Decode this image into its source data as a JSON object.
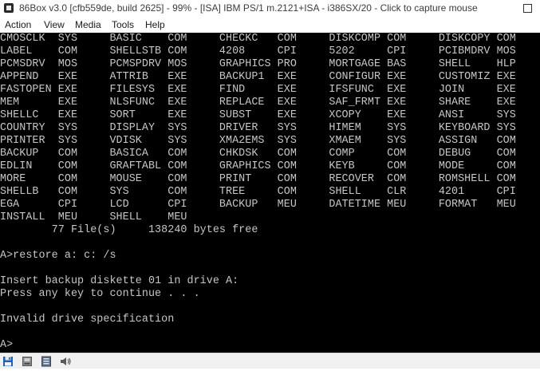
{
  "window": {
    "title": "86Box v3.0 [cfb559de, build 2625] - 99% - [ISA] IBM PS/1 m.2121+ISA - i386SX/20 - Click to capture mouse"
  },
  "menu": {
    "items": [
      "Action",
      "View",
      "Media",
      "Tools",
      "Help"
    ]
  },
  "terminal": {
    "lines": [
      "CMOSCLK  SYS     BASIC    COM     CHECKC   COM     DISKCOMP COM     DISKCOPY COM",
      "LABEL    COM     SHELLSTB COM     4208     CPI     5202     CPI     PCIBMDRV MOS",
      "PCMSDRV  MOS     PCMSPDRV MOS     GRAPHICS PRO     MORTGAGE BAS     SHELL    HLP",
      "APPEND   EXE     ATTRIB   EXE     BACKUP1  EXE     CONFIGUR EXE     CUSTOMIZ EXE",
      "FASTOPEN EXE     FILESYS  EXE     FIND     EXE     IFSFUNC  EXE     JOIN     EXE",
      "MEM      EXE     NLSFUNC  EXE     REPLACE  EXE     SAF_FRMT EXE     SHARE    EXE",
      "SHELLC   EXE     SORT     EXE     SUBST    EXE     XCOPY    EXE     ANSI     SYS",
      "COUNTRY  SYS     DISPLAY  SYS     DRIVER   SYS     HIMEM    SYS     KEYBOARD SYS",
      "PRINTER  SYS     VDISK    SYS     XMA2EMS  SYS     XMAEM    SYS     ASSIGN   COM",
      "BACKUP   COM     BASICA   COM     CHKDSK   COM     COMP     COM     DEBUG    COM",
      "EDLIN    COM     GRAFTABL COM     GRAPHICS COM     KEYB     COM     MODE     COM",
      "MORE     COM     MOUSE    COM     PRINT    COM     RECOVER  COM     ROMSHELL COM",
      "SHELLB   COM     SYS      COM     TREE     COM     SHELL    CLR     4201     CPI",
      "EGA      CPI     LCD      CPI     BACKUP   MEU     DATETIME MEU     FORMAT   MEU",
      "INSTALL  MEU     SHELL    MEU",
      "        77 File(s)     138240 bytes free",
      "",
      "A>restore a: c: /s",
      "",
      "Insert backup diskette 01 in drive A:",
      "Press any key to continue . . .",
      "",
      "Invalid drive specification",
      "",
      "A>"
    ]
  },
  "status_icons": [
    "floppy-drive-icon",
    "hard-disk-icon",
    "cdrom-icon",
    "sound-icon"
  ],
  "colors": {
    "terminal_bg": "#000000",
    "terminal_fg": "#c6c6c6"
  }
}
